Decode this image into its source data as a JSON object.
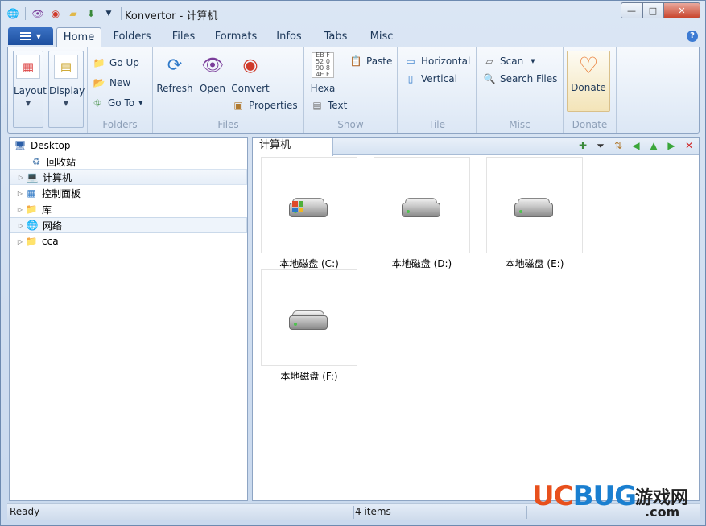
{
  "window": {
    "title": "Konvertor - 计算机",
    "buttons": {
      "minimize": "—",
      "maximize": "□",
      "close": "✕"
    }
  },
  "quick_access": [
    "globe-icon",
    "eye-icon",
    "convert-icon",
    "folder-icon",
    "download-icon",
    "dropdown-icon"
  ],
  "tabs": [
    {
      "label": "Home",
      "active": true
    },
    {
      "label": "Folders"
    },
    {
      "label": "Files"
    },
    {
      "label": "Formats"
    },
    {
      "label": "Infos"
    },
    {
      "label": "Tabs"
    },
    {
      "label": "Misc"
    }
  ],
  "help_label": "?",
  "ribbon": {
    "layout": "Layout",
    "display": "Display",
    "folders": {
      "go_up": "Go Up",
      "new": "New",
      "go_to": "Go To",
      "label": "Folders"
    },
    "files": {
      "refresh": "Refresh",
      "open": "Open",
      "convert": "Convert",
      "properties": "Properties",
      "label": "Files"
    },
    "show": {
      "hexa": "Hexa",
      "paste": "Paste",
      "text": "Text",
      "label": "Show"
    },
    "tile": {
      "horizontal": "Horizontal",
      "vertical": "Vertical",
      "label": "Tile"
    },
    "misc": {
      "scan": "Scan",
      "search_files": "Search Files",
      "label": "Misc"
    },
    "donate": {
      "button": "Donate",
      "label": "Donate"
    }
  },
  "tree": [
    {
      "label": "Desktop",
      "icon": "desktop-icon"
    },
    {
      "label": "回收站",
      "icon": "recycle-bin-icon"
    },
    {
      "label": "计算机",
      "icon": "computer-icon"
    },
    {
      "label": "控制面板",
      "icon": "control-panel-icon"
    },
    {
      "label": "库",
      "icon": "library-icon"
    },
    {
      "label": "网络",
      "icon": "network-icon"
    },
    {
      "label": "cca",
      "icon": "user-folder-icon"
    }
  ],
  "content": {
    "tab_title": "计算机",
    "items": [
      {
        "label": "本地磁盘 (C:)",
        "system": true
      },
      {
        "label": "本地磁盘 (D:)"
      },
      {
        "label": "本地磁盘 (E:)"
      },
      {
        "label": "本地磁盘 (F:)"
      }
    ]
  },
  "status": {
    "left": "Ready",
    "count": "4 items"
  },
  "watermark": {
    "logo_a": "UC",
    "logo_b": "BUG",
    "cn": "游戏网",
    "com": ".com"
  }
}
